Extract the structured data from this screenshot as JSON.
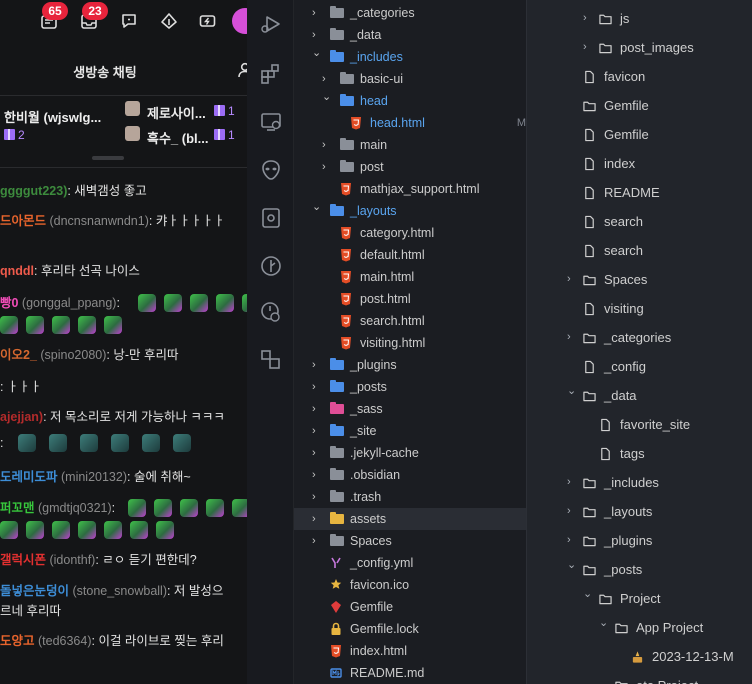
{
  "chat": {
    "badges": {
      "notifications": "65",
      "messages": "23"
    },
    "title": "생방송 채팅",
    "donors": [
      {
        "name": "한비월 (wjswlg...",
        "count": "2"
      },
      {
        "name": "제로사이...",
        "count": "1"
      },
      {
        "name": "흑수_ (bl...",
        "count": "1"
      }
    ],
    "messages": [
      {
        "nick": "ggggut223)",
        "nick_color": "#3d8b3d",
        "uid": "",
        "text": ": 새벽갬성 좋고"
      },
      {
        "nick": "드아몬드",
        "nick_color": "#e8642c",
        "uid": " (dncnsnanwndn1)",
        "text": ": 캬ㅏㅏㅏㅏㅏ"
      },
      {
        "nick": "qnddl",
        "nick_color": "#ef5b4c",
        "uid": "",
        "text": ": 후리타 선곡 나이스"
      },
      {
        "nick": "빵0",
        "nick_color": "#f24db8",
        "uid": " (gonggal_ppang)",
        "text": ":"
      },
      {
        "nick": "이오2_",
        "nick_color": "#d6682f",
        "uid": " (spino2080)",
        "text": ": 낭-만 후리따"
      },
      {
        "nick": "",
        "nick_color": "#e4e4e4",
        "uid": "",
        "text": ": ㅏㅏㅏ"
      },
      {
        "nick": "ajejjan)",
        "nick_color": "#b32b2b",
        "uid": "",
        "text": ": 저 목소리로 저게 가능하나 ㅋㅋㅋ"
      },
      {
        "nick": "",
        "nick_color": "#ef5b4c",
        "uid": "",
        "text": ":"
      },
      {
        "nick": "도레미도파",
        "nick_color": "#3d8dd6",
        "uid": " (mini20132)",
        "text": ": 술에 취해~"
      },
      {
        "nick": "퍼꼬맨",
        "nick_color": "#37c63c",
        "uid": " (gmdtjq0321)",
        "text": ":"
      },
      {
        "nick": "갤럭시폰",
        "nick_color": "#e23030",
        "uid": " (idonthf)",
        "text": ": ㄹㅇ 듣기 편한데?"
      },
      {
        "nick": "돌넣은눈덩이",
        "nick_color": "#3d8dd6",
        "uid": " (stone_snowball)",
        "text": ": 저 발성으"
      },
      {
        "nick": "",
        "nick_color": "#e2e2e2",
        "uid": "",
        "text": "르네 후리따"
      },
      {
        "nick": "도양고",
        "nick_color": "#e8642c",
        "uid": " (ted6364)",
        "text": ": 이걸 라이브로 찢는 후리"
      }
    ]
  },
  "explorer": {
    "items": [
      {
        "label": "_categories",
        "chev": "›",
        "type": "folder",
        "color": "#8a8f98"
      },
      {
        "label": "_data",
        "chev": "›",
        "type": "folder",
        "color": "#8a8f98"
      },
      {
        "label": "_includes",
        "chev": "⌄",
        "type": "folder-open",
        "color": "#4b8ee8"
      },
      {
        "label": "basic-ui",
        "chev": "›",
        "type": "folder",
        "color": "#8a8f98"
      },
      {
        "label": "head",
        "chev": "⌄",
        "type": "folder-open",
        "color": "#4b8ee8"
      },
      {
        "label": "head.html",
        "chev": "",
        "type": "html",
        "color": "#e44d26",
        "mod": "M"
      },
      {
        "label": "main",
        "chev": "›",
        "type": "folder",
        "color": "#8a8f98"
      },
      {
        "label": "post",
        "chev": "›",
        "type": "folder",
        "color": "#8a8f98"
      },
      {
        "label": "mathjax_support.html",
        "chev": "",
        "type": "html",
        "color": "#e44d26"
      },
      {
        "label": "_layouts",
        "chev": "⌄",
        "type": "folder-open",
        "color": "#4b8ee8"
      },
      {
        "label": "category.html",
        "chev": "",
        "type": "html",
        "color": "#e44d26"
      },
      {
        "label": "default.html",
        "chev": "",
        "type": "html",
        "color": "#e44d26"
      },
      {
        "label": "main.html",
        "chev": "",
        "type": "html",
        "color": "#e44d26"
      },
      {
        "label": "post.html",
        "chev": "",
        "type": "html",
        "color": "#e44d26"
      },
      {
        "label": "search.html",
        "chev": "",
        "type": "html",
        "color": "#e44d26"
      },
      {
        "label": "visiting.html",
        "chev": "",
        "type": "html",
        "color": "#e44d26"
      },
      {
        "label": "_plugins",
        "chev": "›",
        "type": "folder",
        "color": "#4b8ee8"
      },
      {
        "label": "_posts",
        "chev": "›",
        "type": "folder",
        "color": "#4b8ee8"
      },
      {
        "label": "_sass",
        "chev": "›",
        "type": "folder",
        "color": "#e04e96"
      },
      {
        "label": "_site",
        "chev": "›",
        "type": "folder",
        "color": "#4b8ee8"
      },
      {
        "label": ".jekyll-cache",
        "chev": "›",
        "type": "folder",
        "color": "#8a8f98"
      },
      {
        "label": ".obsidian",
        "chev": "›",
        "type": "folder",
        "color": "#8a8f98"
      },
      {
        "label": ".trash",
        "chev": "›",
        "type": "folder",
        "color": "#8a8f98"
      },
      {
        "label": "assets",
        "chev": "›",
        "type": "folder",
        "color": "#e7b540"
      },
      {
        "label": "Spaces",
        "chev": "›",
        "type": "folder",
        "color": "#8a8f98"
      },
      {
        "label": "_config.yml",
        "chev": "",
        "type": "yml",
        "color": "#c678dd"
      },
      {
        "label": "favicon.ico",
        "chev": "",
        "type": "star",
        "color": "#e7b540"
      },
      {
        "label": "Gemfile",
        "chev": "",
        "type": "ruby",
        "color": "#e03c3c"
      },
      {
        "label": "Gemfile.lock",
        "chev": "",
        "type": "lock",
        "color": "#e7b540"
      },
      {
        "label": "index.html",
        "chev": "",
        "type": "html",
        "color": "#e44d26"
      },
      {
        "label": "README.md",
        "chev": "",
        "type": "md",
        "color": "#4b8ee8"
      }
    ]
  },
  "outline": {
    "items": [
      {
        "label": "js",
        "chev": "›",
        "type": "folder",
        "indent": 2
      },
      {
        "label": "post_images",
        "chev": "›",
        "type": "folder",
        "indent": 2
      },
      {
        "label": "favicon",
        "chev": "",
        "type": "file",
        "indent": 1
      },
      {
        "label": "Gemfile",
        "chev": "",
        "type": "folder",
        "indent": 1
      },
      {
        "label": "Gemfile",
        "chev": "",
        "type": "file",
        "indent": 1
      },
      {
        "label": "index",
        "chev": "",
        "type": "file",
        "indent": 1
      },
      {
        "label": "README",
        "chev": "",
        "type": "file",
        "indent": 1
      },
      {
        "label": "search",
        "chev": "",
        "type": "file",
        "indent": 1
      },
      {
        "label": "search",
        "chev": "",
        "type": "file",
        "indent": 1
      },
      {
        "label": "Spaces",
        "chev": "›",
        "type": "folder",
        "indent": 1
      },
      {
        "label": "visiting",
        "chev": "",
        "type": "file",
        "indent": 1
      },
      {
        "label": "_categories",
        "chev": "›",
        "type": "folder",
        "indent": 1
      },
      {
        "label": "_config",
        "chev": "",
        "type": "file",
        "indent": 1
      },
      {
        "label": "_data",
        "chev": "⌄",
        "type": "folder",
        "indent": 1
      },
      {
        "label": "favorite_site",
        "chev": "",
        "type": "file",
        "indent": 2
      },
      {
        "label": "tags",
        "chev": "",
        "type": "file",
        "indent": 2
      },
      {
        "label": "_includes",
        "chev": "›",
        "type": "folder",
        "indent": 1
      },
      {
        "label": "_layouts",
        "chev": "›",
        "type": "folder",
        "indent": 1
      },
      {
        "label": "_plugins",
        "chev": "›",
        "type": "folder",
        "indent": 1
      },
      {
        "label": "_posts",
        "chev": "⌄",
        "type": "folder",
        "indent": 1
      },
      {
        "label": "Project",
        "chev": "⌄",
        "type": "folder",
        "indent": 2
      },
      {
        "label": "App Project",
        "chev": "⌄",
        "type": "folder",
        "indent": 3
      },
      {
        "label": "2023-12-13-M",
        "chev": "",
        "type": "image",
        "indent": 4
      },
      {
        "label": "ete Project",
        "chev": "",
        "type": "folder",
        "indent": 3
      }
    ]
  }
}
